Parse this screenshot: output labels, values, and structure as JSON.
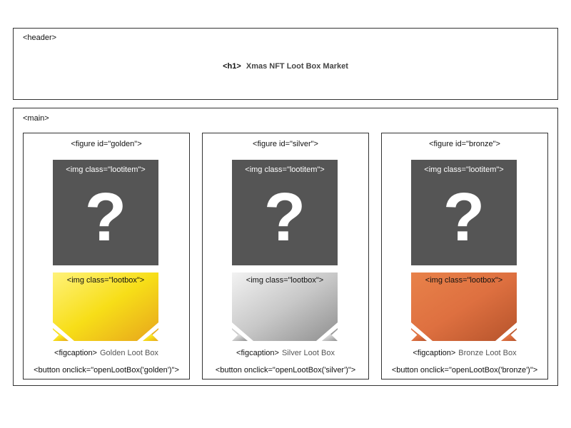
{
  "header": {
    "tag": "<header>"
  },
  "h1": {
    "tag": "<h1>",
    "text": "Xmas NFT Loot Box Market"
  },
  "main": {
    "tag": "<main>"
  },
  "figures": [
    {
      "figure_tag": "<figure id=\"golden\">",
      "lootitem_label": "<img class=\"lootitem\">",
      "question_mark": "?",
      "lootbox_label": "<img class=\"lootbox\">",
      "figcaption_tag": "<figcaption>",
      "caption": "Golden Loot Box",
      "button": "<button onclick=\"openLootBox('golden')\">",
      "colors": {
        "light": "#fff27a",
        "mid": "#f7de18",
        "dark": "#e7a51c"
      }
    },
    {
      "figure_tag": "<figure id=\"silver\">",
      "lootitem_label": "<img class=\"lootitem\">",
      "question_mark": "?",
      "lootbox_label": "<img class=\"lootbox\">",
      "figcaption_tag": "<figcaption>",
      "caption": "Silver Loot Box",
      "button": "<button onclick=\"openLootBox('silver')\">",
      "colors": {
        "light": "#f2f2f2",
        "mid": "#c8c8c8",
        "dark": "#8f8f8f"
      }
    },
    {
      "figure_tag": "<figure id=\"bronze\">",
      "lootitem_label": "<img class=\"lootitem\">",
      "question_mark": "?",
      "lootbox_label": "<img class=\"lootbox\">",
      "figcaption_tag": "<figcaption>",
      "caption": "Bronze Loot Box",
      "button": "<button onclick=\"openLootBox('bronze')\">",
      "colors": {
        "light": "#e8824a",
        "mid": "#de7040",
        "dark": "#b5532b"
      }
    }
  ]
}
